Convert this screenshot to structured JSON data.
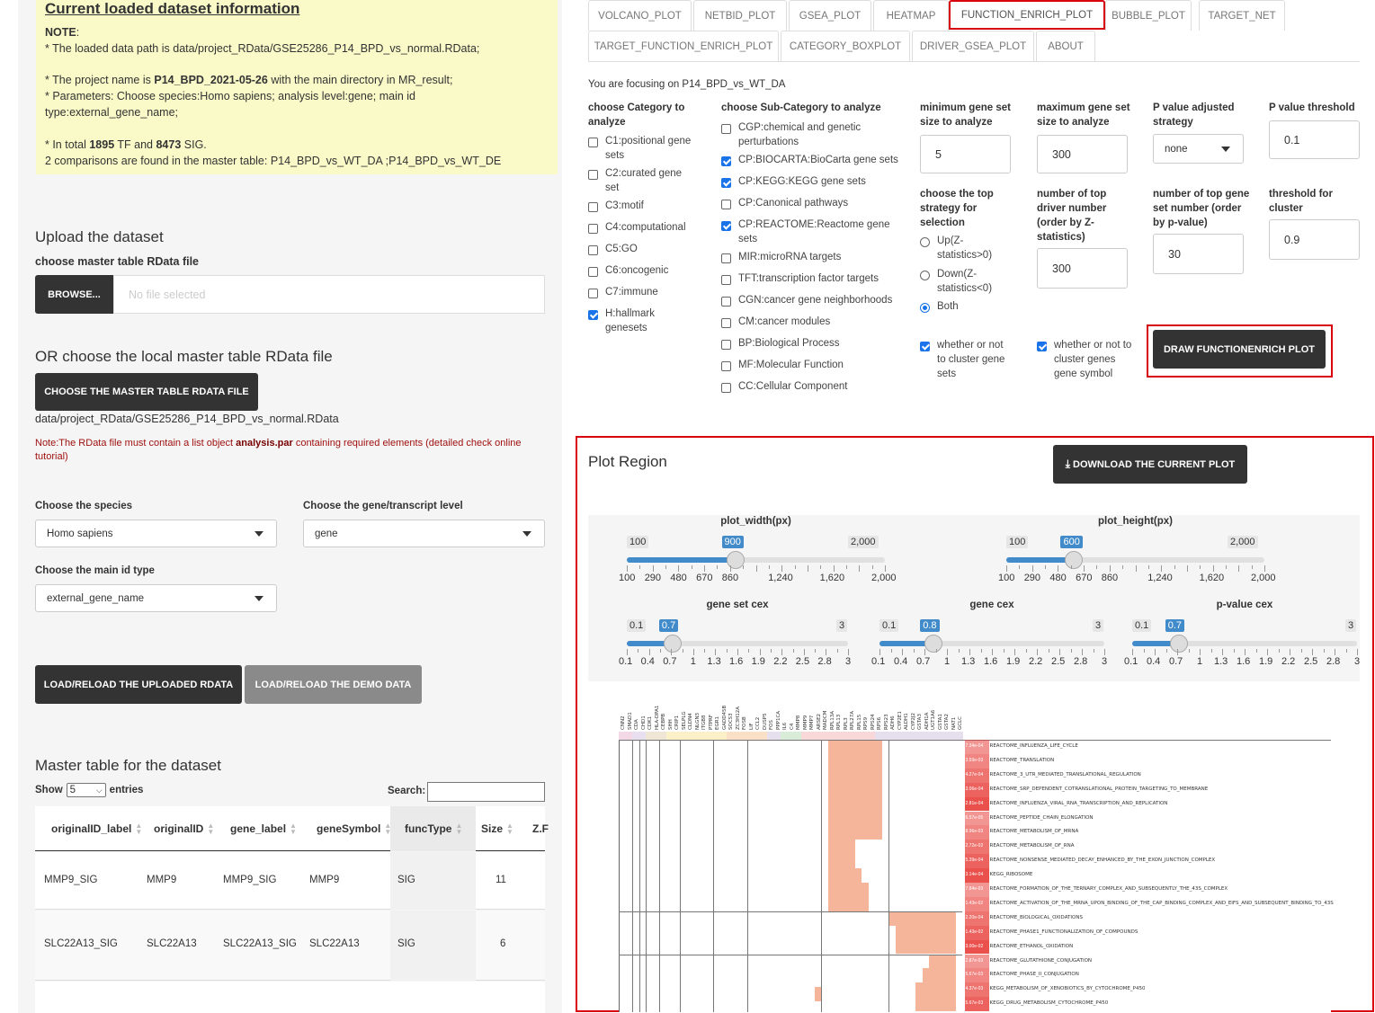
{
  "info": {
    "title": "Current loaded dataset information",
    "note_label": "NOTE",
    "path_line": "* The loaded data path is data/project_RData/GSE25286_P14_BPD_vs_normal.RData;",
    "project_prefix": "* The project name is ",
    "project_name": "P14_BPD_2021-05-26",
    "project_suffix": " with the main directory in MR_result;",
    "params_line": "* Parameters: Choose species:Homo sapiens; analysis level:gene; main id type:external_gene_name;",
    "total_prefix": "* In total ",
    "tf_count": "1895",
    "tf_mid": " TF and ",
    "sig_count": "8473",
    "sig_suffix": " SIG.",
    "comparisons_line": "2 comparisons are found in the master table: P14_BPD_vs_WT_DA ;P14_BPD_vs_WT_DE"
  },
  "upload": {
    "heading": "Upload the dataset",
    "label": "choose master table RData file",
    "browse": "Browse...",
    "placeholder": "No file selected"
  },
  "local": {
    "heading": "OR choose the local master table RData file",
    "button": "Choose the master table RData file",
    "path": "data/project_RData/GSE25286_P14_BPD_vs_normal.RData",
    "note_prefix": "Note:The RData file must contain a list object ",
    "note_bold": "analysis.par",
    "note_suffix": " containing required elements (detailed check online tutorial)"
  },
  "species": {
    "label": "Choose the species",
    "value": "Homo sapiens"
  },
  "level": {
    "label": "Choose the gene/transcript level",
    "value": "gene"
  },
  "idtype": {
    "label": "Choose the main id type",
    "value": "external_gene_name"
  },
  "load_buttons": {
    "uploaded": "Load/Reload the uploaded RData",
    "demo": "Load/Reload the demo data"
  },
  "master_table": {
    "heading": "Master table for the dataset",
    "show": "Show",
    "entries_value": "5",
    "entries": "entries",
    "search": "Search:",
    "columns": [
      "originalID_label",
      "originalID",
      "gene_label",
      "geneSymbol",
      "funcType",
      "Size",
      "Z.F"
    ],
    "rows": [
      [
        "MMP9_SIG",
        "MMP9",
        "MMP9_SIG",
        "MMP9",
        "SIG",
        "11"
      ],
      [
        "SLC22A13_SIG",
        "SLC22A13",
        "SLC22A13_SIG",
        "SLC22A13",
        "SIG",
        "6"
      ]
    ]
  },
  "tabs": [
    "VOLCANO_PLOT",
    "NETBID_PLOT",
    "GSEA_PLOT",
    "HEATMAP",
    "FUNCTION_ENRICH_PLOT",
    "BUBBLE_PLOT",
    "TARGET_NET",
    "TARGET_FUNCTION_ENRICH_PLOT",
    "CATEGORY_BOXPLOT",
    "DRIVER_GSEA_PLOT",
    "ABOUT"
  ],
  "focus": "You are focusing on P14_BPD_vs_WT_DA",
  "category": {
    "label": "choose Category to analyze",
    "items": [
      {
        "text": "C1:positional gene sets",
        "checked": false
      },
      {
        "text": "C2:curated gene set",
        "checked": false
      },
      {
        "text": "C3:motif",
        "checked": false
      },
      {
        "text": "C4:computational",
        "checked": false
      },
      {
        "text": "C5:GO",
        "checked": false
      },
      {
        "text": "C6:oncogenic",
        "checked": false
      },
      {
        "text": "C7:immune",
        "checked": false
      },
      {
        "text": "H:hallmark genesets",
        "checked": true
      }
    ]
  },
  "subcategory": {
    "label": "choose Sub-Category to analyze",
    "items": [
      {
        "text": "CGP:chemical and genetic perturbations",
        "checked": false
      },
      {
        "text": "CP:BIOCARTA:BioCarta gene sets",
        "checked": true
      },
      {
        "text": "CP:KEGG:KEGG gene sets",
        "checked": true
      },
      {
        "text": "CP:Canonical pathways",
        "checked": false
      },
      {
        "text": "CP:REACTOME:Reactome gene sets",
        "checked": true
      },
      {
        "text": "MIR:microRNA targets",
        "checked": false
      },
      {
        "text": "TFT:transcription factor targets",
        "checked": false
      },
      {
        "text": "CGN:cancer gene neighborhoods",
        "checked": false
      },
      {
        "text": "CM:cancer modules",
        "checked": false
      },
      {
        "text": "BP:Biological Process",
        "checked": false
      },
      {
        "text": "MF:Molecular Function",
        "checked": false
      },
      {
        "text": "CC:Cellular Component",
        "checked": false
      }
    ]
  },
  "params": {
    "min_label": "minimum gene set size to analyze",
    "min_value": "5",
    "max_label": "maximum gene set size to analyze",
    "max_value": "300",
    "padj_label": "P value adjusted strategy",
    "padj_value": "none",
    "pthr_label": "P value threshold",
    "pthr_value": "0.1",
    "strategy_label": "choose the top strategy for selection",
    "strategy_options": [
      "Up(Z-statistics>0)",
      "Down(Z-statistics<0)",
      "Both"
    ],
    "strategy_selected": "Both",
    "ndriver_label": "number of top driver number (order by Z-statistics)",
    "ndriver_value": "300",
    "ngs_label": "number of top gene set number (order by p-value)",
    "ngs_value": "30",
    "cluster_label": "threshold for cluster",
    "cluster_value": "0.9",
    "cluster_gs_label": "whether or not to cluster gene sets",
    "cluster_genes_label": "whether or not to cluster genes gene symbol",
    "draw_button": "DRAW FUNCTIONENRICH PLOT"
  },
  "plot_region": {
    "title": "Plot Region",
    "download": "DOWNLOAD THE CURRENT PLOT",
    "sliders": [
      {
        "name": "plot_width(px)",
        "min": "100",
        "max": "2,000",
        "value": "900",
        "frac": 0.42,
        "ticks": [
          "100",
          "290",
          "480",
          "670",
          "860",
          "1,240",
          "1,620",
          "2,000"
        ]
      },
      {
        "name": "plot_height(px)",
        "min": "100",
        "max": "2,000",
        "value": "600",
        "frac": 0.263,
        "ticks": [
          "100",
          "290",
          "480",
          "670",
          "860",
          "1,240",
          "1,620",
          "2,000"
        ]
      },
      {
        "name": "gene set cex",
        "min": "0.1",
        "max": "3",
        "value": "0.7",
        "frac": 0.207,
        "ticks": [
          "0.1",
          "0.4",
          "0.7",
          "1",
          "1.3",
          "1.6",
          "1.9",
          "2.2",
          "2.5",
          "2.8",
          "3"
        ]
      },
      {
        "name": "gene cex",
        "min": "0.1",
        "max": "3",
        "value": "0.8",
        "frac": 0.241,
        "ticks": [
          "0.1",
          "0.4",
          "0.7",
          "1",
          "1.3",
          "1.6",
          "1.9",
          "2.2",
          "2.5",
          "2.8",
          "3"
        ]
      },
      {
        "name": "p-value cex",
        "min": "0.1",
        "max": "3",
        "value": "0.7",
        "frac": 0.207,
        "ticks": [
          "0.1",
          "0.4",
          "0.7",
          "1",
          "1.3",
          "1.6",
          "1.9",
          "2.2",
          "2.5",
          "2.8",
          "3"
        ]
      }
    ]
  },
  "heatmap": {
    "genes": [
      "CNN2",
      "SMAD1",
      "CDA",
      "CHD1",
      "CDK1",
      "HLA-DPA1",
      "CEBPB",
      "SHH",
      "CRIP1",
      "SELPLG",
      "CLDN4",
      "NLGN3",
      "ITGB8",
      "PTPRF",
      "EGR1",
      "GADD45B",
      "SOCS3",
      "ZC3H12A",
      "FOSB",
      "LIF",
      "CCL2",
      "DUSP5",
      "FOS",
      "PPP1CA",
      "IL6",
      "C4",
      "MMP8",
      "MMP9",
      "MMP7",
      "ARSE2",
      "MADCM",
      "RPL13A",
      "RPL13",
      "RPL3",
      "RPL27A",
      "RPL15",
      "RPS9",
      "RPS24",
      "RPS6",
      "RPS23",
      "ADH6",
      "CYP2E1",
      "ALDH1",
      "CYP2J2",
      "GSTA3",
      "ADH1A",
      "UGT1A6",
      "GSTA1",
      "GSTA2",
      "NAT1",
      "GCLC"
    ],
    "pathways": [
      {
        "p": "7.34e-04",
        "name": "REACTOME_INFLUENZA_LIFE_CYCLE"
      },
      {
        "p": "3.59e-03",
        "name": "REACTOME_TRANSLATION"
      },
      {
        "p": "4.27e-04",
        "name": "REACTOME_3_UTR_MEDIATED_TRANSLATIONAL_REGULATION"
      },
      {
        "p": "3.06e-04",
        "name": "REACTOME_SRP_DEPENDENT_COTRANSLATIONAL_PROTEIN_TARGETING_TO_MEMBRANE"
      },
      {
        "p": "2.81e-04",
        "name": "REACTOME_INFLUENZA_VIRAL_RNA_TRANSCRIPTION_AND_REPLICATION"
      },
      {
        "p": "6.57e-05",
        "name": "REACTOME_PEPTIDE_CHAIN_ELONGATION"
      },
      {
        "p": "8.96e-03",
        "name": "REACTOME_METABOLISM_OF_MRNA"
      },
      {
        "p": "2.72e-02",
        "name": "REACTOME_METABOLISM_OF_RNA"
      },
      {
        "p": "5.39e-04",
        "name": "REACTOME_NONSENSE_MEDIATED_DECAY_ENHANCED_BY_THE_EXON_JUNCTION_COMPLEX"
      },
      {
        "p": "3.14e-04",
        "name": "KEGG_RIBOSOME"
      },
      {
        "p": "7.84e-03",
        "name": "REACTOME_FORMATION_OF_THE_TERNARY_COMPLEX_AND_SUBSEQUENTLY_THE_43S_COMPLEX"
      },
      {
        "p": "1.43e-02",
        "name": "REACTOME_ACTIVATION_OF_THE_MRNA_UPON_BINDING_OF_THE_CAP_BINDING_COMPLEX_AND_EIFS_AND_SUBSEQUENT_BINDING_TO_43S"
      },
      {
        "p": "2.20e-04",
        "name": "REACTOME_BIOLOGICAL_OXIDATIONS"
      },
      {
        "p": "1.43e-02",
        "name": "REACTOME_PHASE1_FUNCTIONALIZATION_OF_COMPOUNDS"
      },
      {
        "p": "3.00e-02",
        "name": "REACTOME_ETHANOL_OXIDATION"
      },
      {
        "p": "2.87e-03",
        "name": "REACTOME_GLUTATHIONE_CONJUGATION"
      },
      {
        "p": "5.67e-03",
        "name": "REACTOME_PHASE_II_CONJUGATION"
      },
      {
        "p": "4.37e-03",
        "name": "KEGG_METABOLISM_OF_XENOBIOTICS_BY_CYTOCHROME_P450"
      },
      {
        "p": "5.67e-03",
        "name": "KEGG_DRUG_METABOLISM_CYTOCHROME_P450"
      }
    ],
    "colors": {
      "cell": "#f4b59a",
      "pvalue": "#e8403a",
      "accent": "#d9000d",
      "slider": "#428bca"
    }
  }
}
